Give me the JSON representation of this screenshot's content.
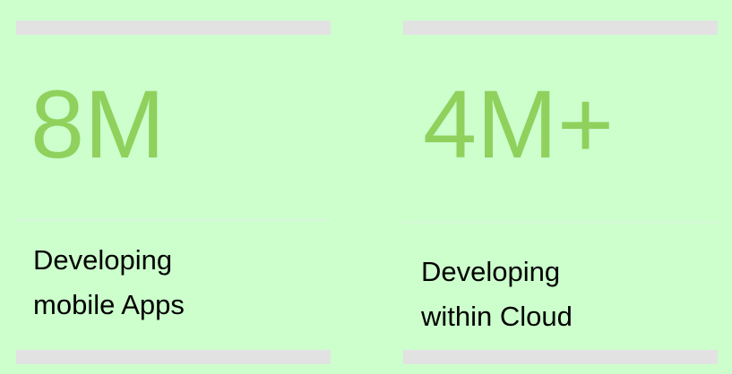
{
  "tiles": [
    {
      "value": "8M",
      "caption_line1": "Developing",
      "caption_line2": "mobile Apps"
    },
    {
      "value": "4M+",
      "caption_line1": "Developing",
      "caption_line2": "within Cloud"
    }
  ],
  "colors": {
    "background": "#ccffcc",
    "stat": "#8fd15c",
    "bar": "#e2e2e2",
    "caption": "#000000"
  }
}
